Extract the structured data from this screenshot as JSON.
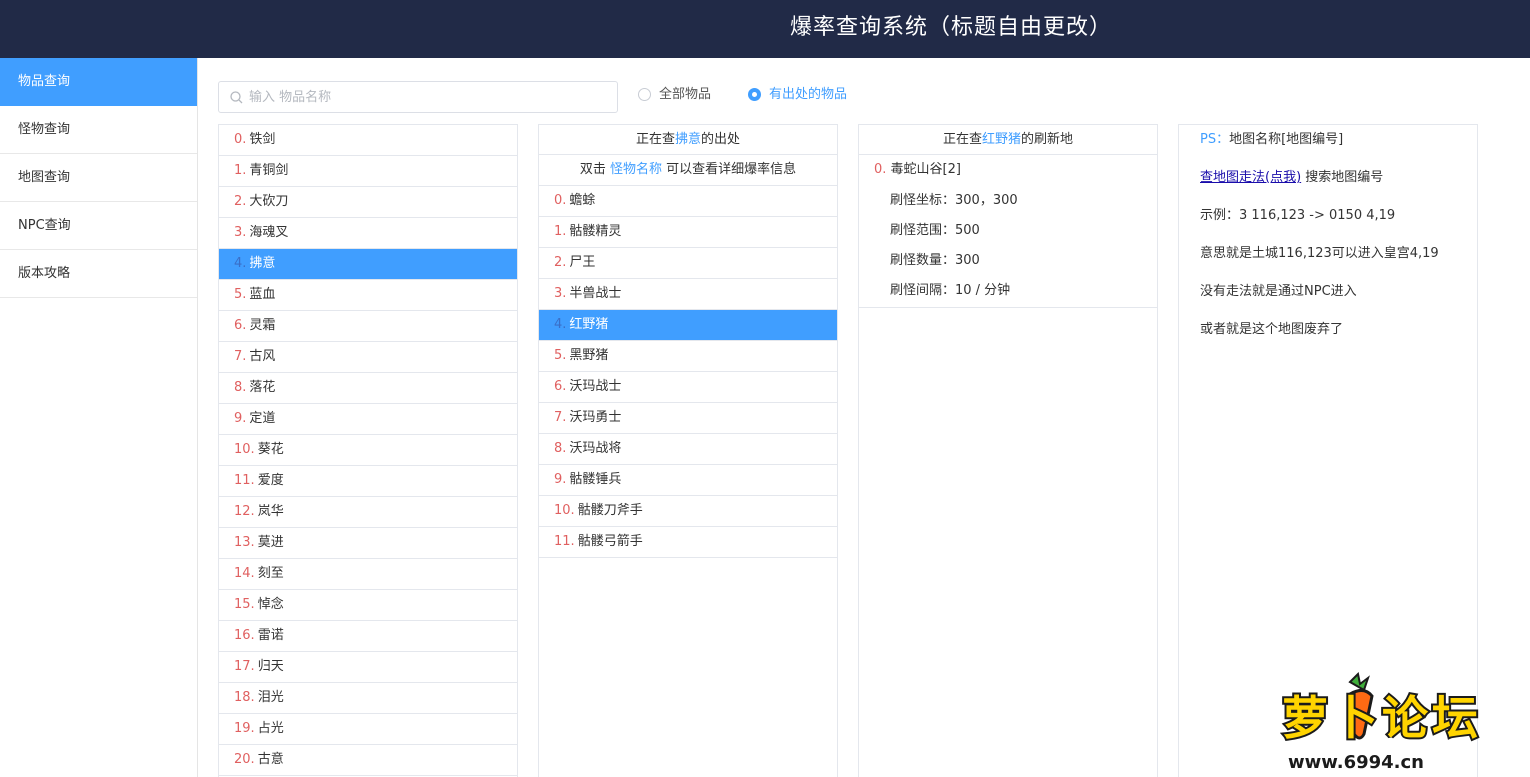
{
  "header": {
    "title": "爆率查询系统（标题自由更改）"
  },
  "sidebar": {
    "items": [
      {
        "label": "物品查询",
        "active": true
      },
      {
        "label": "怪物查询",
        "active": false
      },
      {
        "label": "地图查询",
        "active": false
      },
      {
        "label": "NPC查询",
        "active": false
      },
      {
        "label": "版本攻略",
        "active": false
      }
    ]
  },
  "search": {
    "placeholder": "输入 物品名称",
    "value": ""
  },
  "filter": {
    "options": [
      {
        "label": "全部物品",
        "checked": false
      },
      {
        "label": "有出处的物品",
        "checked": true
      }
    ]
  },
  "items_panel": {
    "selected_index": 4,
    "rows": [
      {
        "index": "0.",
        "name": "铁剑"
      },
      {
        "index": "1.",
        "name": "青铜剑"
      },
      {
        "index": "2.",
        "name": "大砍刀"
      },
      {
        "index": "3.",
        "name": "海魂叉"
      },
      {
        "index": "4.",
        "name": "拂意"
      },
      {
        "index": "5.",
        "name": "蓝血"
      },
      {
        "index": "6.",
        "name": "灵霜"
      },
      {
        "index": "7.",
        "name": "古风"
      },
      {
        "index": "8.",
        "name": "落花"
      },
      {
        "index": "9.",
        "name": "定道"
      },
      {
        "index": "10.",
        "name": "葵花"
      },
      {
        "index": "11.",
        "name": "爱度"
      },
      {
        "index": "12.",
        "name": "岚华"
      },
      {
        "index": "13.",
        "name": "莫进"
      },
      {
        "index": "14.",
        "name": "刻至"
      },
      {
        "index": "15.",
        "name": "悼念"
      },
      {
        "index": "16.",
        "name": "雷诺"
      },
      {
        "index": "17.",
        "name": "归天"
      },
      {
        "index": "18.",
        "name": "泪光"
      },
      {
        "index": "19.",
        "name": "占光"
      },
      {
        "index": "20.",
        "name": "古意"
      }
    ]
  },
  "monsters_panel": {
    "head_prefix": "正在查",
    "head_item": "拂意",
    "head_suffix": "的出处",
    "hint_prefix": "双击",
    "hint_key": "怪物名称",
    "hint_suffix": "可以查看详细爆率信息",
    "selected_index": 4,
    "rows": [
      {
        "index": "0.",
        "name": "蟾蜍"
      },
      {
        "index": "1.",
        "name": "骷髅精灵"
      },
      {
        "index": "2.",
        "name": "尸王"
      },
      {
        "index": "3.",
        "name": "半兽战士"
      },
      {
        "index": "4.",
        "name": "红野猪"
      },
      {
        "index": "5.",
        "name": "黑野猪"
      },
      {
        "index": "6.",
        "name": "沃玛战士"
      },
      {
        "index": "7.",
        "name": "沃玛勇士"
      },
      {
        "index": "8.",
        "name": "沃玛战将"
      },
      {
        "index": "9.",
        "name": "骷髅锤兵"
      },
      {
        "index": "10.",
        "name": "骷髅刀斧手"
      },
      {
        "index": "11.",
        "name": "骷髅弓箭手"
      }
    ]
  },
  "maps_panel": {
    "head_prefix": "正在查",
    "head_monster": "红野猪",
    "head_suffix": "的刷新地",
    "entry": {
      "index": "0.",
      "name": "毒蛇山谷[2]",
      "details": [
        "刷怪坐标：300，300",
        "刷怪范围：500",
        "刷怪数量：300",
        "刷怪间隔：10 / 分钟"
      ]
    }
  },
  "info_panel": {
    "ps_key": "PS：",
    "ps_text": "地图名称[地图编号]",
    "link_text": "查地图走法(点我)",
    "link_suffix": " 搜索地图编号",
    "example": "示例：3 116,123 -> 0150 4,19",
    "meaning": "意思就是土城116,123可以进入皇宫4,19",
    "npc_note": "没有走法就是通过NPC进入",
    "abandoned": "或者就是这个地图废弃了"
  },
  "watermark": {
    "text": "萝卜论坛",
    "site": "www.6994.cn"
  },
  "colors": {
    "header_bg": "#212a47",
    "accent": "#409eff",
    "index": "#e06060"
  }
}
